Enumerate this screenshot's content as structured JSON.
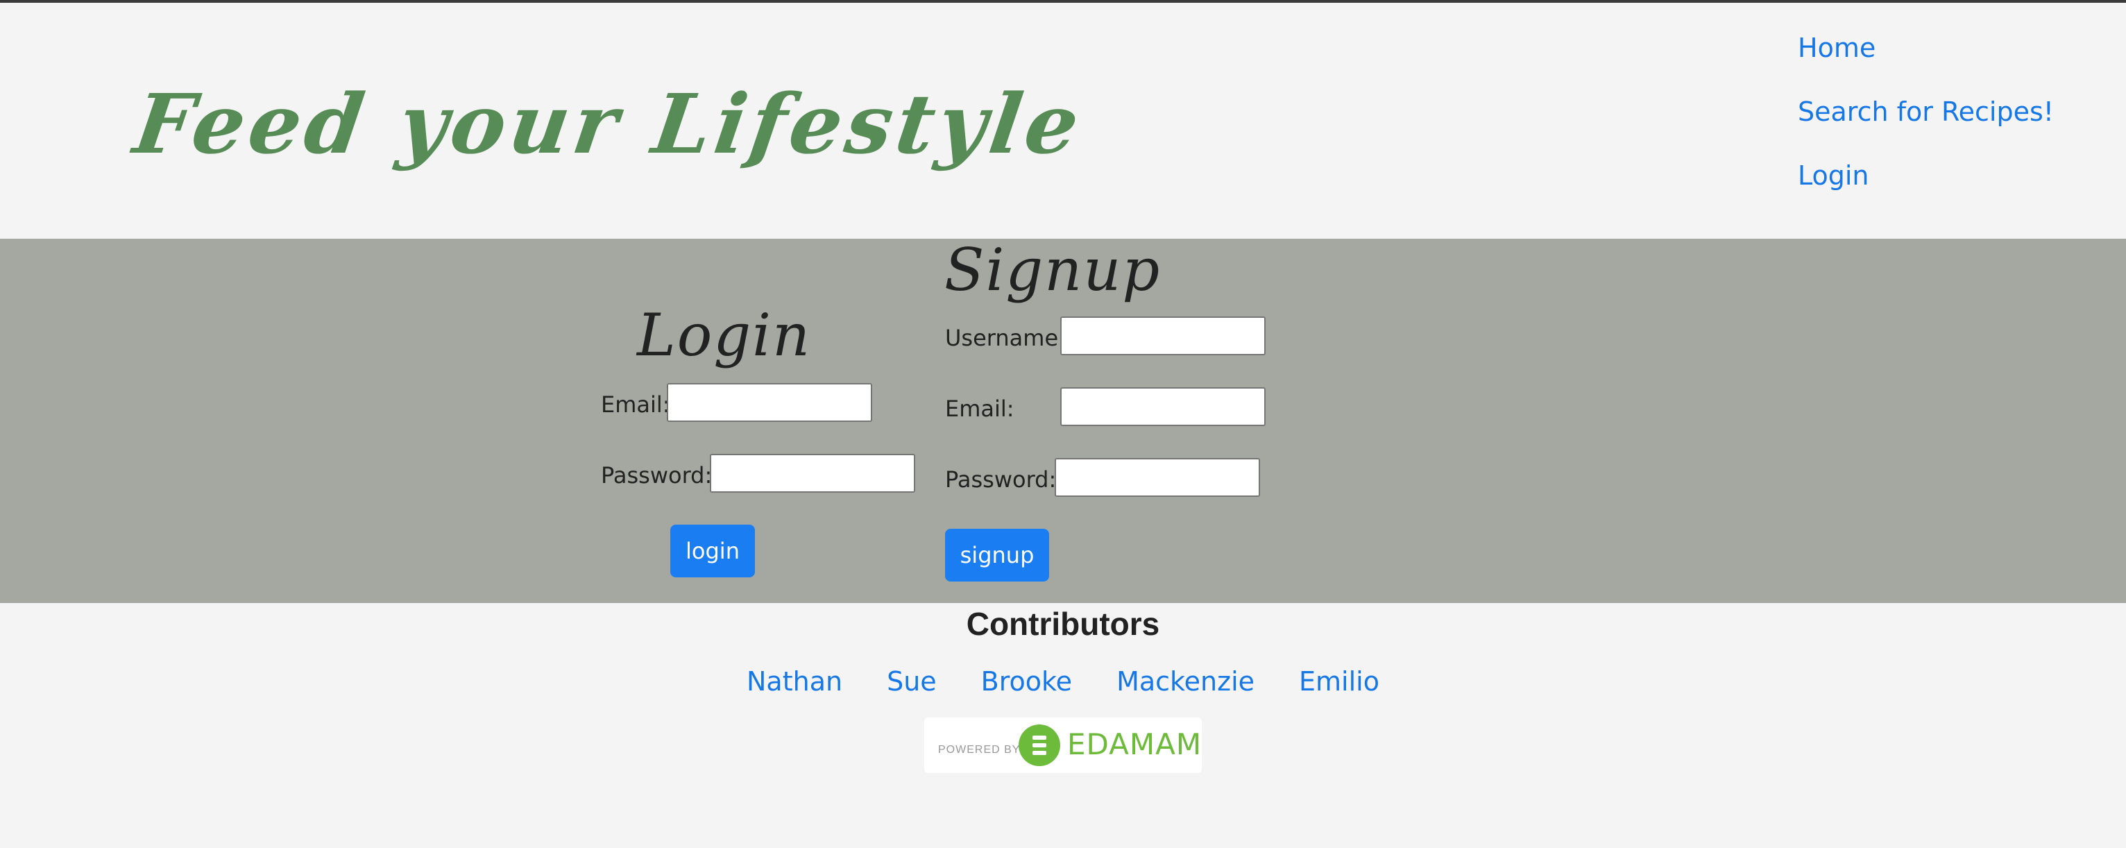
{
  "header": {
    "site_title": "Feed your Lifestyle",
    "nav": [
      {
        "label": "Home"
      },
      {
        "label": "Search for Recipes!"
      },
      {
        "label": "Login"
      }
    ]
  },
  "login": {
    "title": "Login",
    "email_label": "Email:",
    "email_value": "",
    "password_label": "Password:",
    "password_value": "",
    "button_label": "login"
  },
  "signup": {
    "title": "Signup",
    "username_label": "Username:",
    "username_value": "",
    "email_label": "Email:",
    "email_value": "",
    "password_label": "Password:",
    "password_value": "",
    "button_label": "signup"
  },
  "footer": {
    "contributors_title": "Contributors",
    "contributors": [
      {
        "name": "Nathan"
      },
      {
        "name": "Sue"
      },
      {
        "name": "Brooke"
      },
      {
        "name": "Mackenzie"
      },
      {
        "name": "Emilio"
      }
    ],
    "badge": {
      "powered_by": "POWERED BY",
      "brand": "EDAMAM",
      "icon": "edamam-logo-icon"
    }
  },
  "colors": {
    "title_green": "#578c57",
    "link_blue": "#1677e6",
    "button_blue": "#1a7ef2",
    "band_gray": "#a4a8a1",
    "page_bg": "#f4f4f4",
    "edamam_green": "#6dbb3b"
  }
}
